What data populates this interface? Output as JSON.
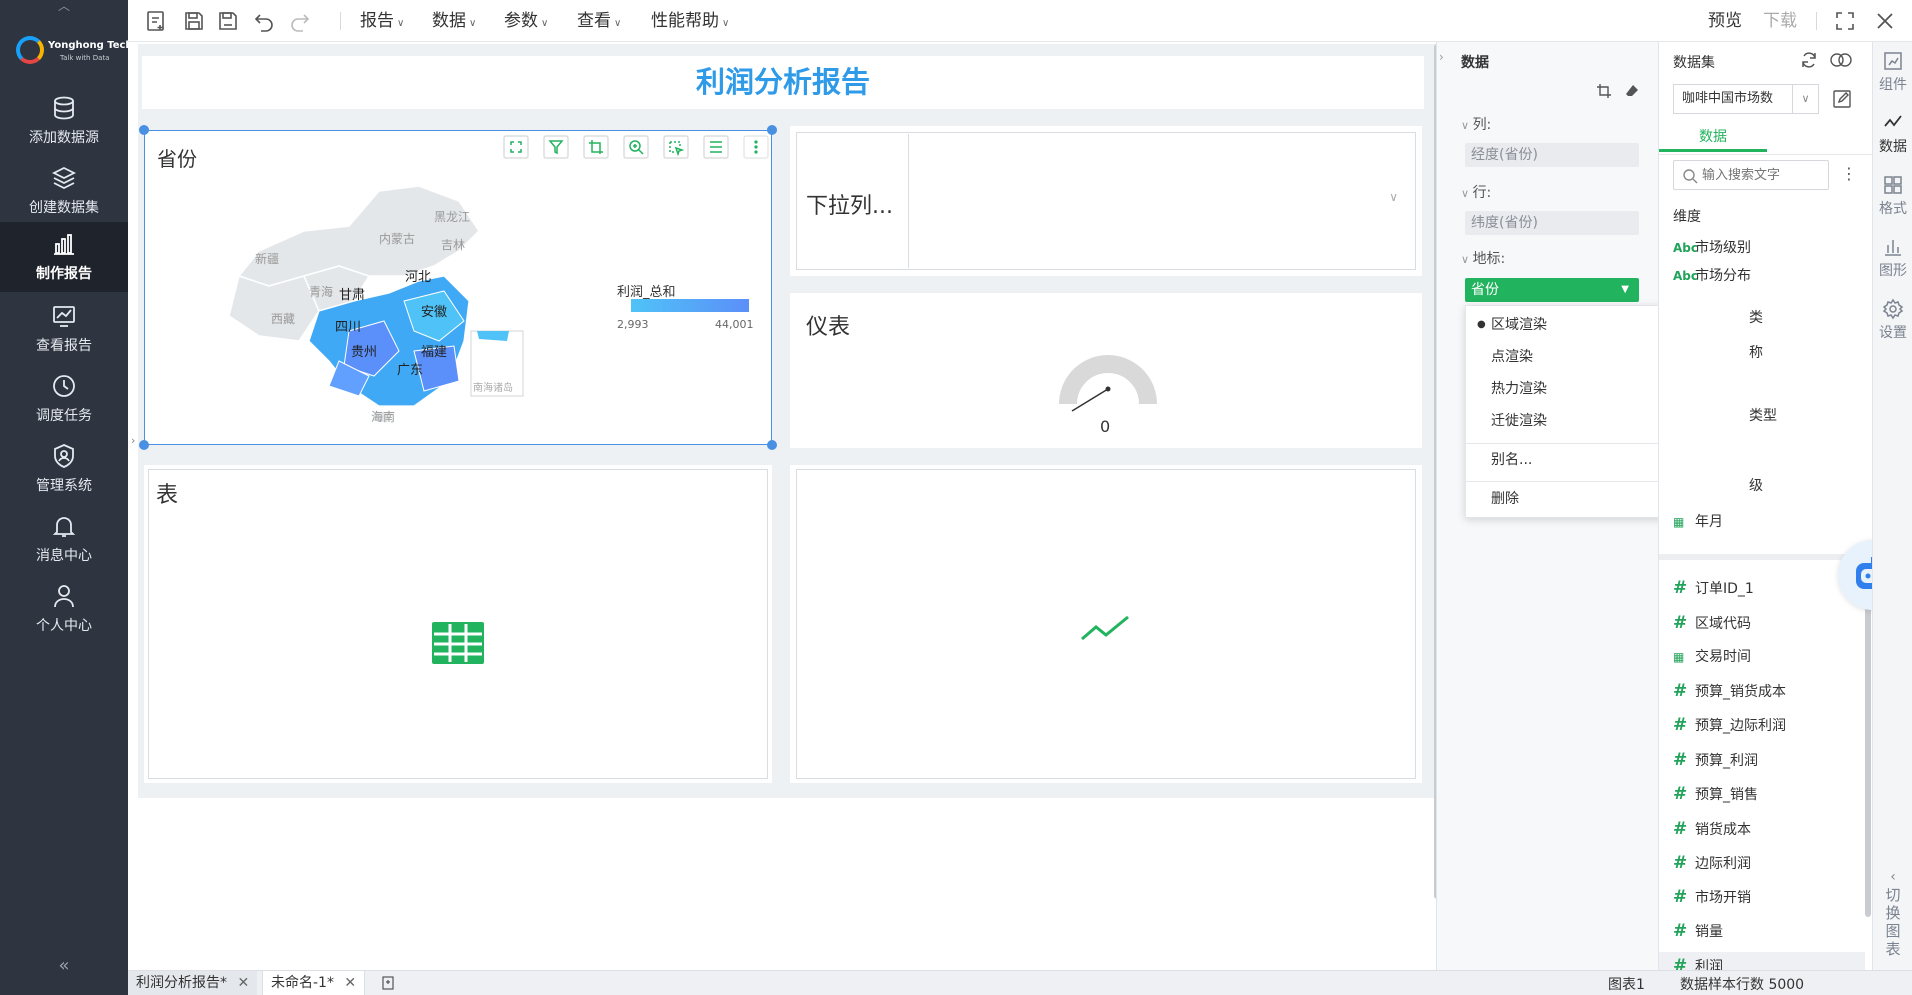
{
  "nav": {
    "logo_brand": "Yonghong Tech",
    "logo_tag": "Talk with Data",
    "items": [
      {
        "label": "添加数据源"
      },
      {
        "label": "创建数据集"
      },
      {
        "label": "制作报告"
      },
      {
        "label": "查看报告"
      },
      {
        "label": "调度任务"
      },
      {
        "label": "管理系统"
      },
      {
        "label": "消息中心"
      },
      {
        "label": "个人中心"
      }
    ],
    "active_index": 2
  },
  "toolbar": {
    "menus": [
      "报告",
      "数据",
      "参数",
      "查看",
      "性能帮助"
    ],
    "preview": "预览",
    "download": "下载"
  },
  "report": {
    "title": "利润分析报告",
    "map": {
      "title": "省份",
      "legend_title": "利润_总和",
      "legend_min": "2,993",
      "legend_max": "44,001",
      "inset_label": "南海诸岛",
      "regions": [
        "黑龙江",
        "吉林",
        "内蒙古",
        "新疆",
        "青海",
        "西藏",
        "甘肃",
        "河北",
        "四川",
        "安徽",
        "贵州",
        "福建",
        "广东",
        "海南"
      ]
    },
    "dropdown": {
      "title": "下拉列..."
    },
    "gauge": {
      "title": "仪表",
      "value": "0"
    },
    "table": {
      "title": "表"
    }
  },
  "data_panel": {
    "title": "数据",
    "col_label": "列:",
    "col_field": "经度(省份)",
    "row_label": "行:",
    "row_field": "纬度(省份)",
    "geo_label": "地标:",
    "geo_field": "省份",
    "context_menu": {
      "items": [
        "区域渲染",
        "点渲染",
        "热力渲染",
        "迁徙渲染",
        "别名...",
        "删除"
      ],
      "selected": "区域渲染"
    }
  },
  "dataset_panel": {
    "title": "数据集",
    "dataset_name": "咖啡中国市场数",
    "tab": "数据",
    "search_placeholder": "输入搜索文字",
    "dim_header": "维度",
    "dimensions": [
      {
        "type": "Abc",
        "name": "市场级别"
      },
      {
        "type": "Abc",
        "name": "市场分布"
      },
      {
        "type": "Abc",
        "name": "类"
      },
      {
        "type": "Abc",
        "name": "称"
      },
      {
        "type": "Abc",
        "name": "类型"
      },
      {
        "type": "Abc",
        "name": "级"
      },
      {
        "type": "date",
        "name": "年月"
      }
    ],
    "measures": [
      {
        "type": "#",
        "name": "订单ID_1"
      },
      {
        "type": "#",
        "name": "区域代码"
      },
      {
        "type": "date",
        "name": "交易时间"
      },
      {
        "type": "#",
        "name": "预算_销货成本"
      },
      {
        "type": "#",
        "name": "预算_边际利润"
      },
      {
        "type": "#",
        "name": "预算_利润"
      },
      {
        "type": "#",
        "name": "预算_销售"
      },
      {
        "type": "#",
        "name": "销货成本"
      },
      {
        "type": "#",
        "name": "边际利润"
      },
      {
        "type": "#",
        "name": "市场开销"
      },
      {
        "type": "#",
        "name": "销量"
      },
      {
        "type": "#",
        "name": "利润"
      }
    ]
  },
  "rail": {
    "items": [
      "组件",
      "数据",
      "格式",
      "图形",
      "设置"
    ],
    "switch_chart": [
      "切",
      "换",
      "图",
      "表"
    ]
  },
  "status": {
    "tabs": [
      "利润分析报告*",
      "未命名-1*"
    ],
    "chart_name": "图表1",
    "sample_rows": "数据样本行数 5000"
  },
  "colors": {
    "accent_green": "#22b35e",
    "title_blue": "#2f9be8",
    "nav_bg": "#2e3440"
  }
}
